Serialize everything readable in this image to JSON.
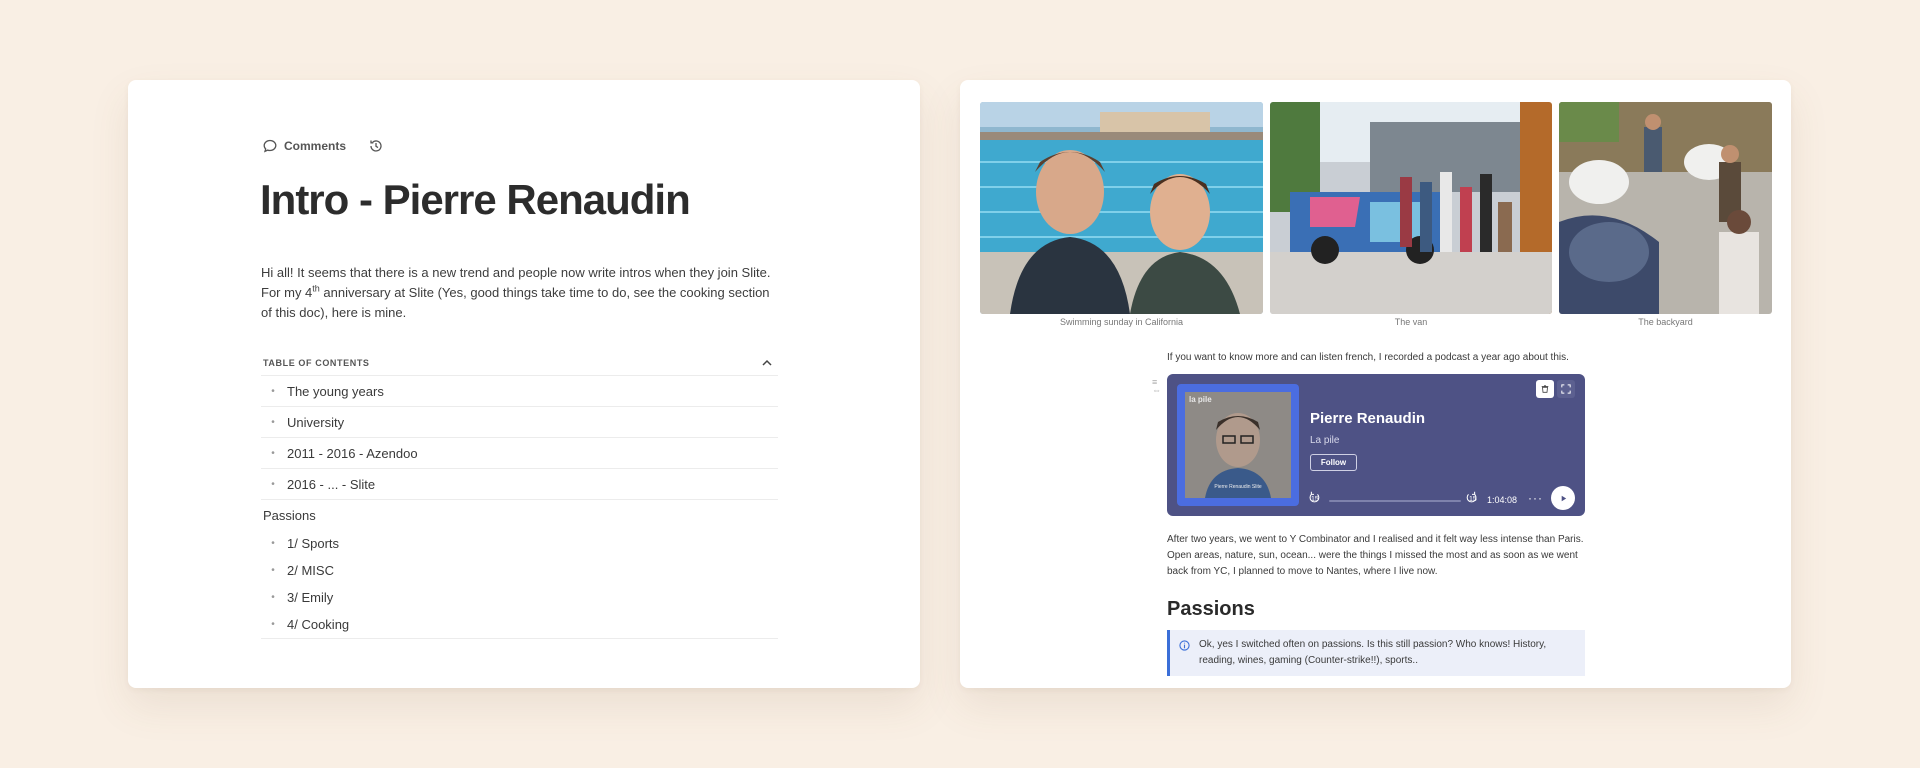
{
  "colors": {
    "background": "#f9efe4",
    "player": "#4e5285",
    "cover_accent": "#4b6de0",
    "callout_bg": "#eceff9",
    "callout_border": "#3b6fd8"
  },
  "left": {
    "toolbar": {
      "comments_label": "Comments",
      "comments_icon": "speech-bubble-icon",
      "history_icon": "history-icon"
    },
    "title": "Intro - Pierre Renaudin",
    "intro": {
      "part1": "Hi all! It seems that there is a new trend and people now write intros when they join Slite. For my 4",
      "sup": "th",
      "part2": " anniversary at Slite (Yes, good things take time to do, see the cooking section of this doc), here is mine."
    },
    "toc": {
      "heading": "TABLE OF CONTENTS",
      "collapse_icon": "chevron-up-icon",
      "items": [
        "The young years",
        "University",
        "2011 - 2016 - Azendoo",
        "2016 - ... - Slite"
      ],
      "section": "Passions",
      "sub_items": [
        "1/ Sports",
        "2/ MISC",
        "3/ Emily",
        "4/ Cooking"
      ]
    }
  },
  "right": {
    "photos": [
      {
        "caption": "Swimming sunday in California"
      },
      {
        "caption": "The van"
      },
      {
        "caption": "The backyard"
      }
    ],
    "podcast_intro": "If you want to know more and can listen french, I recorded a podcast a year ago about this.",
    "player": {
      "title": "Pierre Renaudin",
      "show": "La pile",
      "follow_label": "Follow",
      "cover_logo": "la pile",
      "cover_text": "Pierre Renaudin Slite",
      "rewind_label": "15",
      "forward_label": "15",
      "time": "1:04:08",
      "more_label": "···",
      "progress": 0.0
    },
    "paragraph": "After two years, we went to Y Combinator and I realised and it felt way less intense than Paris. Open areas, nature, sun, ocean... were the things I missed the most and as soon as we went back from YC, I planned to move to Nantes, where I live now.",
    "heading": "Passions",
    "callout": "Ok, yes I switched often on passions. Is this still passion? Who knows! History, reading, wines, gaming (Counter-strike!!), sports.."
  }
}
